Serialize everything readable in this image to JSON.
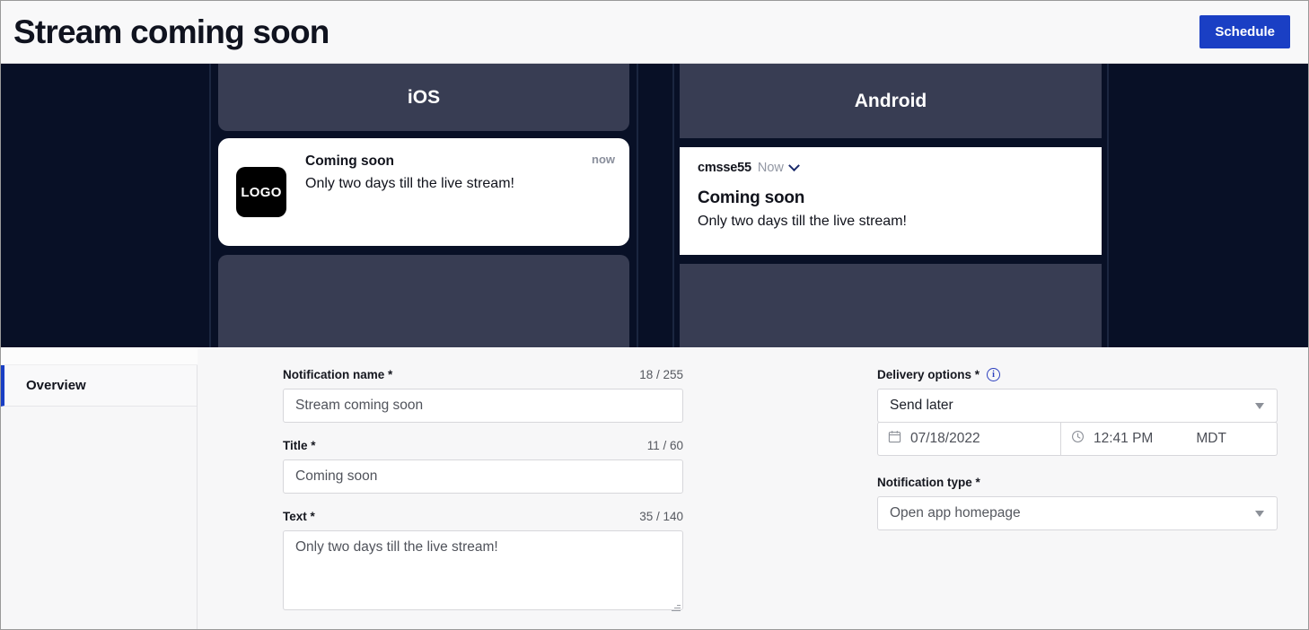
{
  "header": {
    "title": "Stream coming soon",
    "schedule_label": "Schedule"
  },
  "preview": {
    "ios": {
      "platform_label": "iOS",
      "logo_label": "LOGO",
      "title": "Coming soon",
      "text": "Only two days till the live stream!",
      "time": "now"
    },
    "android": {
      "platform_label": "Android",
      "app_name": "cmsse55",
      "time": "Now",
      "title": "Coming soon",
      "text": "Only two days till the live stream!"
    }
  },
  "sidebar": {
    "items": [
      {
        "label": "Overview"
      }
    ]
  },
  "form": {
    "notification_name": {
      "label": "Notification name *",
      "counter": "18 / 255",
      "value": "Stream coming soon"
    },
    "title": {
      "label": "Title *",
      "counter": "11 / 60",
      "value": "Coming soon"
    },
    "text": {
      "label": "Text *",
      "counter": "35 / 140",
      "value": "Only two days till the live stream!"
    },
    "delivery_options": {
      "label": "Delivery options *",
      "value": "Send later",
      "date": "07/18/2022",
      "time": "12:41 PM",
      "timezone": "MDT"
    },
    "notification_type": {
      "label": "Notification type *",
      "value": "Open app homepage"
    }
  },
  "colors": {
    "accent": "#1a3fc4",
    "preview_bg": "#081026",
    "phone_chrome": "#383d53"
  }
}
